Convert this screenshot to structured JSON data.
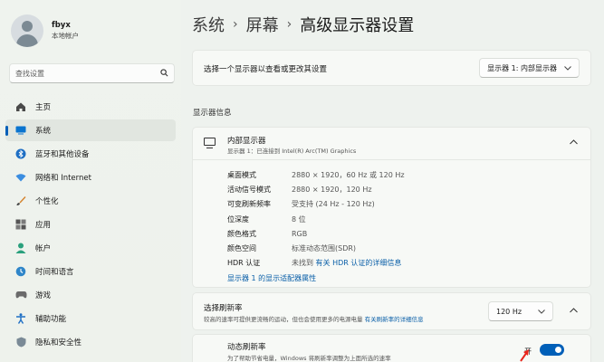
{
  "user": {
    "name": "fbyx",
    "account_type": "本地帐户"
  },
  "search": {
    "placeholder": "查找设置",
    "icon": "search-icon"
  },
  "nav": {
    "items": [
      {
        "label": "主页",
        "icon": "home-icon",
        "active": false
      },
      {
        "label": "系统",
        "icon": "system-icon",
        "active": true
      },
      {
        "label": "蓝牙和其他设备",
        "icon": "bluetooth-icon",
        "active": false
      },
      {
        "label": "网络和 Internet",
        "icon": "wifi-icon",
        "active": false
      },
      {
        "label": "个性化",
        "icon": "brush-icon",
        "active": false
      },
      {
        "label": "应用",
        "icon": "apps-icon",
        "active": false
      },
      {
        "label": "帐户",
        "icon": "account-icon",
        "active": false
      },
      {
        "label": "时间和语言",
        "icon": "globe-clock-icon",
        "active": false
      },
      {
        "label": "游戏",
        "icon": "gamepad-icon",
        "active": false
      },
      {
        "label": "辅助功能",
        "icon": "accessibility-icon",
        "active": false
      },
      {
        "label": "隐私和安全性",
        "icon": "shield-icon",
        "active": false
      }
    ]
  },
  "breadcrumb": {
    "items": [
      "系统",
      "屏幕",
      "高级显示器设置"
    ],
    "separator": "›"
  },
  "display_select": {
    "label": "选择一个显示器以查看或更改其设置",
    "value": "显示器 1: 内部显示器"
  },
  "section_title": "显示器信息",
  "display": {
    "title": "内部显示器",
    "subtitle": "显示器 1：已连接到 Intel(R) Arc(TM) Graphics",
    "rows": [
      {
        "key": "桌面模式",
        "value": "2880 × 1920，60 Hz 或 120 Hz",
        "link": ""
      },
      {
        "key": "活动信号模式",
        "value": "2880 × 1920，120 Hz",
        "link": ""
      },
      {
        "key": "可变刷新频率",
        "value": "受支持 (24 Hz - 120 Hz)",
        "link": ""
      },
      {
        "key": "位深度",
        "value": "8 位",
        "link": ""
      },
      {
        "key": "颜色格式",
        "value": "RGB",
        "link": ""
      },
      {
        "key": "颜色空间",
        "value": "标准动态范围(SDR)",
        "link": ""
      },
      {
        "key": "HDR 认证",
        "value": "未找到 ",
        "link": "有关 HDR 认证的详细信息"
      }
    ],
    "adapter_link": "显示器 1 的显示适配器属性"
  },
  "refresh": {
    "title": "选择刷新率",
    "subtitle": "较高的速率可提供更流畅的运动，但也会使用更多的电源电量 ",
    "subtitle_link": "有关刷新率的详细信息",
    "value": "120 Hz"
  },
  "dynamic": {
    "title": "动态刷新率",
    "subtitle": "为了帮助节省电量，Windows 将刷新率调整为上面所选的速率",
    "toggle_label": "开",
    "toggle_on": true
  },
  "colors": {
    "accent": "#005fb8",
    "link": "#0a5fa8",
    "annotation_arrow": "#e8261d"
  }
}
